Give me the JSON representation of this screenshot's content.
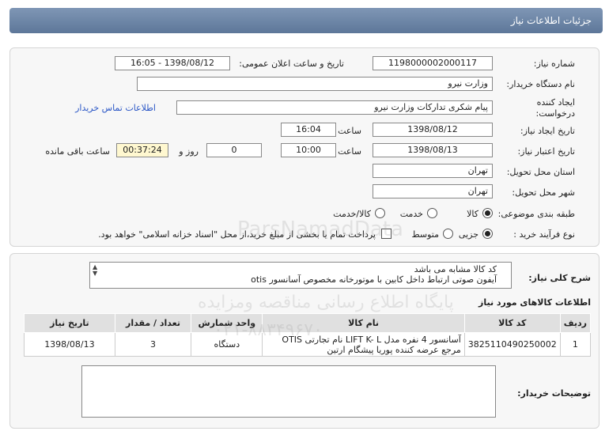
{
  "header": {
    "title": "جزئیات اطلاعات نیاز"
  },
  "form": {
    "need_number_label": "شماره نیاز:",
    "need_number": "1198000002000117",
    "announce_label": "تاریخ و ساعت اعلان عمومی:",
    "announce_value": "1398/08/12 - 16:05",
    "buyer_org_label": "نام دستگاه خریدار:",
    "buyer_org": "وزارت نیرو",
    "creator_label": "ایجاد کننده درخواست:",
    "creator": "پیام شکری تدارکات وزارت نیرو",
    "contact_link": "اطلاعات تماس خریدار",
    "create_date_label": "تاریخ ایجاد نیاز:",
    "create_date": "1398/08/12",
    "time_label": "ساعت",
    "create_time": "16:04",
    "validity_label": "تاریخ اعتبار نیاز:",
    "validity_date": "1398/08/13",
    "validity_time": "10:00",
    "days_value": "0",
    "days_label": "روز و",
    "remaining_time": "00:37:24",
    "remaining_label": "ساعت باقی مانده",
    "province_label": "استان محل تحویل:",
    "province": "تهران",
    "city_label": "شهر محل تحویل:",
    "city": "تهران",
    "category_label": "طبقه بندی موضوعی:",
    "category_options": [
      "کالا",
      "خدمت",
      "کالا/خدمت"
    ],
    "category_selected": "کالا",
    "process_label": "نوع فرآیند خرید :",
    "process_options": [
      "جزیی",
      "متوسط"
    ],
    "process_selected": "جزیی",
    "payment_note": "پرداخت تمام یا بخشی از مبلغ خرید،از محل \"اسناد خزانه اسلامی\" خواهد بود."
  },
  "description": {
    "label": "شرح کلی نیاز:",
    "lines": [
      "کد کالا مشابه می باشد",
      "آیفون صوتی ارتباط داخل کابین با موتورخانه مخصوص آسانسور otis"
    ]
  },
  "items": {
    "title": "اطلاعات کالاهای مورد نیاز",
    "columns": [
      "ردیف",
      "کد کالا",
      "نام کالا",
      "واحد شمارش",
      "تعداد / مقدار",
      "تاریخ نیاز"
    ],
    "rows": [
      {
        "row": "1",
        "code": "3825110490250002",
        "name": "آسانسور 4 نفره مدل LIFT K- L نام تجارتی OTIS مرجع عرضه کننده پوریا پیشگام ارتین",
        "unit": "دستگاه",
        "qty": "3",
        "date": "1398/08/13"
      }
    ]
  },
  "buyer_notes": {
    "label": "توضیحات خریدار:",
    "value": ""
  },
  "watermark": {
    "line1": "ParsNamadData",
    "line2": "پایگاه اطلاع رسانی مناقصه ومزایده",
    "line3": "۰۲۱-۸۸۳۴۹۶۷۰"
  }
}
